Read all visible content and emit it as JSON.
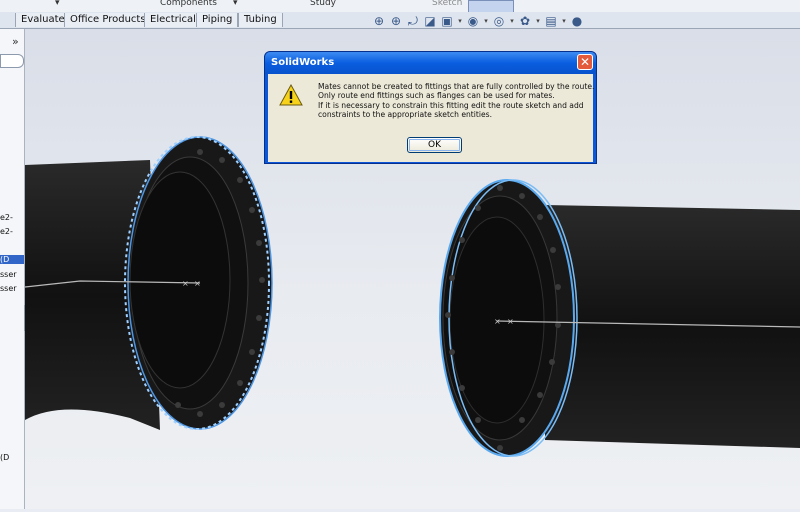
{
  "top_strip": {
    "components_label": "Components",
    "study_label": "Study",
    "sketch_label": "Sketch"
  },
  "tabs": [
    "Evaluate",
    "Office Products",
    "Electrical",
    "Piping",
    "Tubing"
  ],
  "view_tools": [
    {
      "icon": "zoom-fit-icon",
      "glyph": "⊕"
    },
    {
      "icon": "zoom-area-icon",
      "glyph": "⊕"
    },
    {
      "icon": "previous-view-icon",
      "glyph": "⤾"
    },
    {
      "icon": "section-view-icon",
      "glyph": "◪"
    },
    {
      "icon": "view-orientation-icon",
      "glyph": "▣"
    },
    {
      "icon": "display-style-icon",
      "glyph": "◉"
    },
    {
      "icon": "hide-show-icon",
      "glyph": "◎"
    },
    {
      "icon": "appearance-icon",
      "glyph": "✿"
    },
    {
      "icon": "scene-icon",
      "glyph": "▤"
    },
    {
      "icon": "realview-icon",
      "glyph": "●"
    }
  ],
  "left_panel": {
    "expand_glyph": "»",
    "items": [
      {
        "text": "e2-",
        "selected": false
      },
      {
        "text": "e2-",
        "selected": false
      },
      {
        "text": "(D",
        "selected": true
      },
      {
        "text": "sser",
        "selected": false
      },
      {
        "text": "sser",
        "selected": false
      },
      {
        "text": "(D",
        "selected": false
      }
    ]
  },
  "dialog": {
    "title": "SolidWorks",
    "close_glyph": "✕",
    "message_lines": [
      "Mates cannot be created to fittings that are fully controlled by the route.",
      "Only route end fittings such as flanges can be used for mates.",
      "If it is necessary to constrain this fitting edit the route sketch and add",
      "constraints to the appropriate sketch entities."
    ],
    "ok_label": "OK"
  },
  "colors": {
    "pipe": "#141414",
    "highlight": "#5aa9ef",
    "dialog_frame": "#0b57d8",
    "dialog_body": "#ece9d8"
  }
}
